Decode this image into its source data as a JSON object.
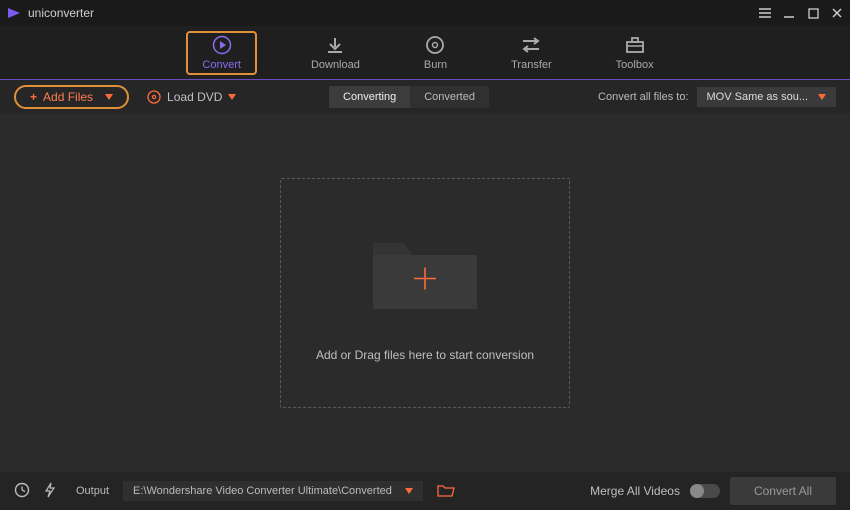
{
  "app": {
    "title": "uniconverter"
  },
  "nav": {
    "items": [
      {
        "label": "Convert"
      },
      {
        "label": "Download"
      },
      {
        "label": "Burn"
      },
      {
        "label": "Transfer"
      },
      {
        "label": "Toolbox"
      }
    ]
  },
  "toolbar": {
    "add_files": "Add Files",
    "load_dvd": "Load DVD",
    "tabs": {
      "converting": "Converting",
      "converted": "Converted"
    },
    "convert_all_label": "Convert all files to:",
    "format_value": "MOV Same as sou..."
  },
  "dropzone": {
    "hint": "Add or Drag files here to start conversion"
  },
  "footer": {
    "output_label": "Output",
    "output_path": "E:\\Wondershare Video Converter Ultimate\\Converted",
    "merge_label": "Merge All Videos",
    "convert_all": "Convert All"
  },
  "colors": {
    "accent": "#8b6cf2",
    "highlight": "#e09038",
    "orange": "#ff6a3c"
  }
}
